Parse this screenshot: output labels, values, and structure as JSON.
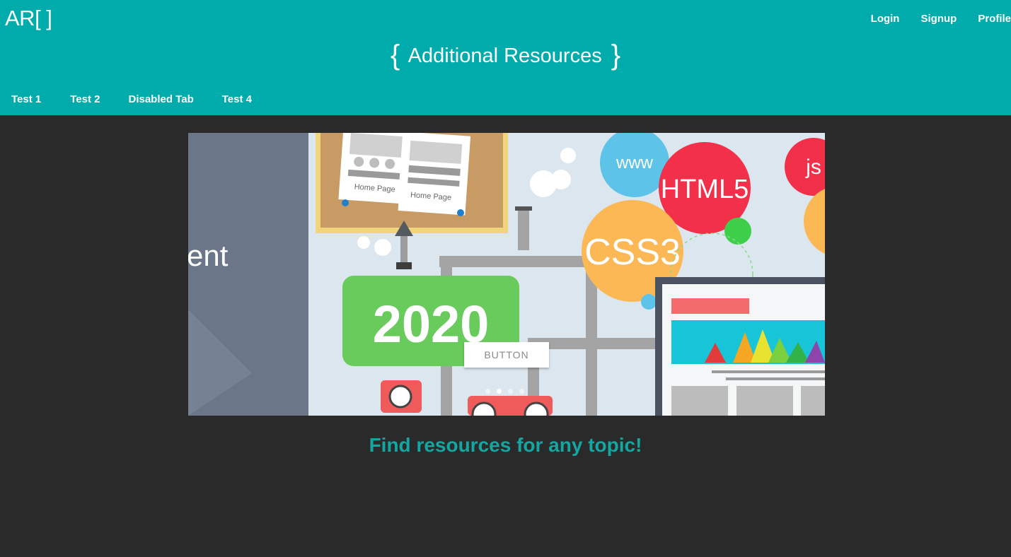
{
  "header": {
    "logo": "AR[ ]",
    "title_open": "{",
    "title": "Additional Resources",
    "title_close": "}",
    "nav": {
      "login": "Login",
      "signup": "Signup",
      "profile": "Profile"
    },
    "tabs": [
      "Test 1",
      "Test 2",
      "Disabled Tab",
      "Test 4"
    ]
  },
  "carousel": {
    "slide_left_text": "ent",
    "board_caption_1": "Home Page",
    "board_caption_2": "Home Page",
    "year": "2020",
    "bubbles": {
      "www": "www",
      "html": "HTML5",
      "css": "CSS3",
      "js": "js"
    },
    "button_label": "BUTTON",
    "indicator_count": 4,
    "active_indicator": 2
  },
  "tagline": "Find resources for any topic!",
  "colors": {
    "primary": "#00abab",
    "background": "#2a2a2a",
    "tagline": "#14a7a2"
  }
}
